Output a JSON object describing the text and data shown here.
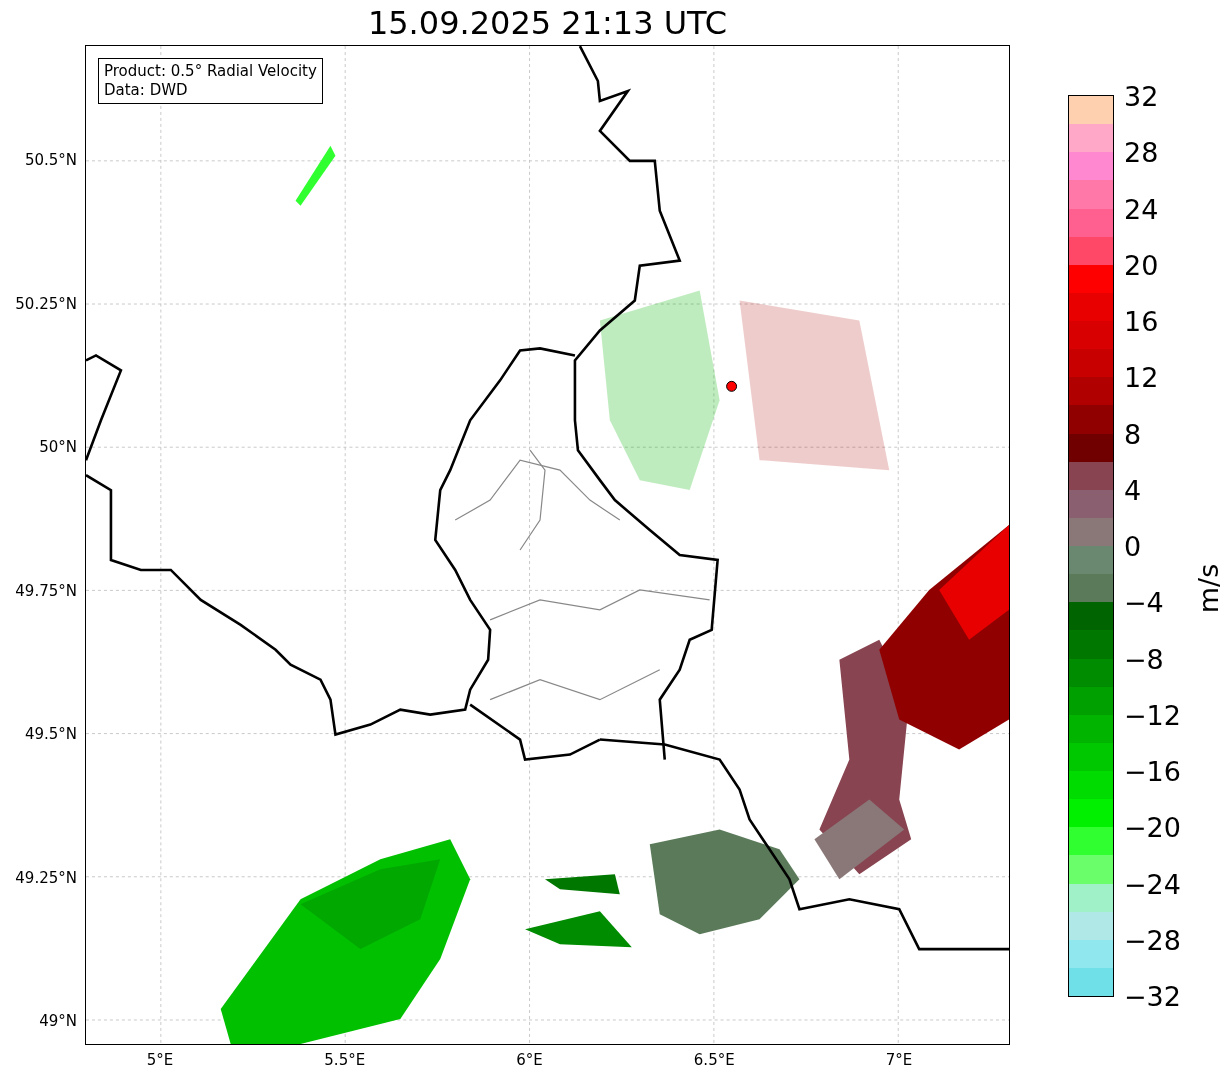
{
  "title": "15.09.2025 21:13 UTC",
  "info_box": {
    "lines": [
      "Product: 0.5° Radial Velocity",
      "Data: DWD"
    ]
  },
  "y_ticks": [
    "50.5°N",
    "50.25°N",
    "50°N",
    "49.75°N",
    "49.5°N",
    "49.25°N",
    "49°N"
  ],
  "x_ticks": [
    "5°E",
    "5.5°E",
    "6°E",
    "6.5°E",
    "7°E"
  ],
  "colorbar": {
    "label": "m/s",
    "ticks": [
      "32",
      "28",
      "24",
      "20",
      "16",
      "12",
      "8",
      "4",
      "0",
      "−4",
      "−8",
      "−12",
      "−16",
      "−20",
      "−24",
      "−28",
      "−32"
    ],
    "bands": [
      {
        "color": "#ffd0b0"
      },
      {
        "color": "#ffa8c8"
      },
      {
        "color": "#ff88d0"
      },
      {
        "color": "#ff78a8"
      },
      {
        "color": "#ff6090"
      },
      {
        "color": "#ff4868"
      },
      {
        "color": "#ff0000"
      },
      {
        "color": "#e80000"
      },
      {
        "color": "#d80000"
      },
      {
        "color": "#c80000"
      },
      {
        "color": "#b00000"
      },
      {
        "color": "#900000"
      },
      {
        "color": "#700000"
      },
      {
        "color": "#884450"
      },
      {
        "color": "#8a6070"
      },
      {
        "color": "#8a7878"
      },
      {
        "color": "#6a8870"
      },
      {
        "color": "#5a7a5a"
      },
      {
        "color": "#006400"
      },
      {
        "color": "#007800"
      },
      {
        "color": "#008c00"
      },
      {
        "color": "#00a000"
      },
      {
        "color": "#00b400"
      },
      {
        "color": "#00c800"
      },
      {
        "color": "#00dc00"
      },
      {
        "color": "#00f000"
      },
      {
        "color": "#30ff30"
      },
      {
        "color": "#6aff6a"
      },
      {
        "color": "#a0f0c8"
      },
      {
        "color": "#b0e8e8"
      },
      {
        "color": "#90e8ee"
      },
      {
        "color": "#70e0e8"
      }
    ]
  }
}
